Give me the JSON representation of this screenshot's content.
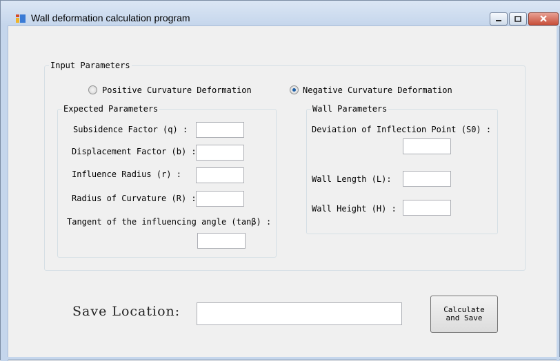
{
  "window": {
    "title": "Wall deformation calculation program"
  },
  "input_group": {
    "legend": "Input Parameters",
    "curvature_options": [
      {
        "label": "Positive Curvature Deformation",
        "checked": false
      },
      {
        "label": "Negative Curvature Deformation",
        "checked": true
      }
    ]
  },
  "expected_group": {
    "legend": "Expected Parameters",
    "fields": [
      {
        "label": "Subsidence Factor (q) :",
        "value": ""
      },
      {
        "label": "Displacement Factor (b) :",
        "value": ""
      },
      {
        "label": "Influence Radius (r) :",
        "value": ""
      },
      {
        "label": "Radius of Curvature (R) :",
        "value": ""
      },
      {
        "label": "Tangent of the influencing angle (tanβ) :",
        "value": ""
      }
    ]
  },
  "wall_group": {
    "legend": "Wall Parameters",
    "fields": [
      {
        "label": "Deviation of Inflection Point (S0) :",
        "value": ""
      },
      {
        "label": "Wall Length (L):",
        "value": ""
      },
      {
        "label": "Wall Height (H) :",
        "value": ""
      }
    ]
  },
  "save": {
    "label": "Save Location:",
    "value": ""
  },
  "calculate_button": {
    "label": "Calculate\nand Save"
  }
}
